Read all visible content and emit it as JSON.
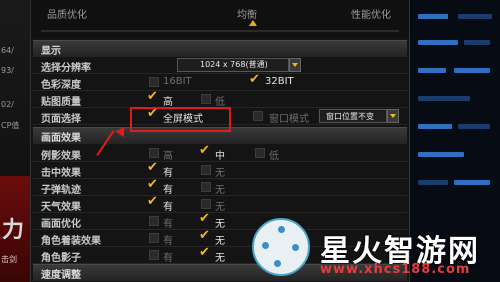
{
  "left_strip": {
    "texts": [
      "64/",
      "93/",
      "02/",
      "CP值"
    ],
    "banner_char": "力",
    "banner_sub": "击剑"
  },
  "slider": {
    "left_label": "品质优化",
    "mid_label": "均衡",
    "right_label": "性能优化"
  },
  "sections": {
    "display": "显示",
    "effects": "画面效果",
    "speed": "速度调整"
  },
  "display": {
    "resolution": {
      "label": "选择分辨率",
      "value": "1024 x 768(普通)"
    },
    "color_depth": {
      "label": "色彩深度",
      "opt1": "16BIT",
      "opt2": "32BIT"
    },
    "texture": {
      "label": "贴图质量",
      "opt1": "高",
      "opt2": "低"
    },
    "screen_mode": {
      "label": "页面选择",
      "fullscreen": "全屏模式",
      "windowed": "窗口模式",
      "window_pos": "窗口位置不变"
    }
  },
  "effects": {
    "rows": [
      {
        "label": "例影效果",
        "opt1": "高",
        "opt2": "中",
        "opt3": "低"
      },
      {
        "label": "击中效果",
        "opt1": "有",
        "opt2": "无"
      },
      {
        "label": "子弹轨迹",
        "opt1": "有",
        "opt2": "无"
      },
      {
        "label": "天气效果",
        "opt1": "有",
        "opt2": "无"
      },
      {
        "label": "画面优化",
        "opt1": "有",
        "opt2": "无"
      },
      {
        "label": "角色着装效果",
        "opt1": "有",
        "opt2": "无"
      },
      {
        "label": "角色影子",
        "opt1": "有",
        "opt2": "无"
      }
    ]
  },
  "watermark": {
    "cn": "星火智游网",
    "url": "www.xhcs188.com"
  },
  "colors": {
    "accent": "#f2b81e",
    "highlight": "#e11b1b"
  }
}
